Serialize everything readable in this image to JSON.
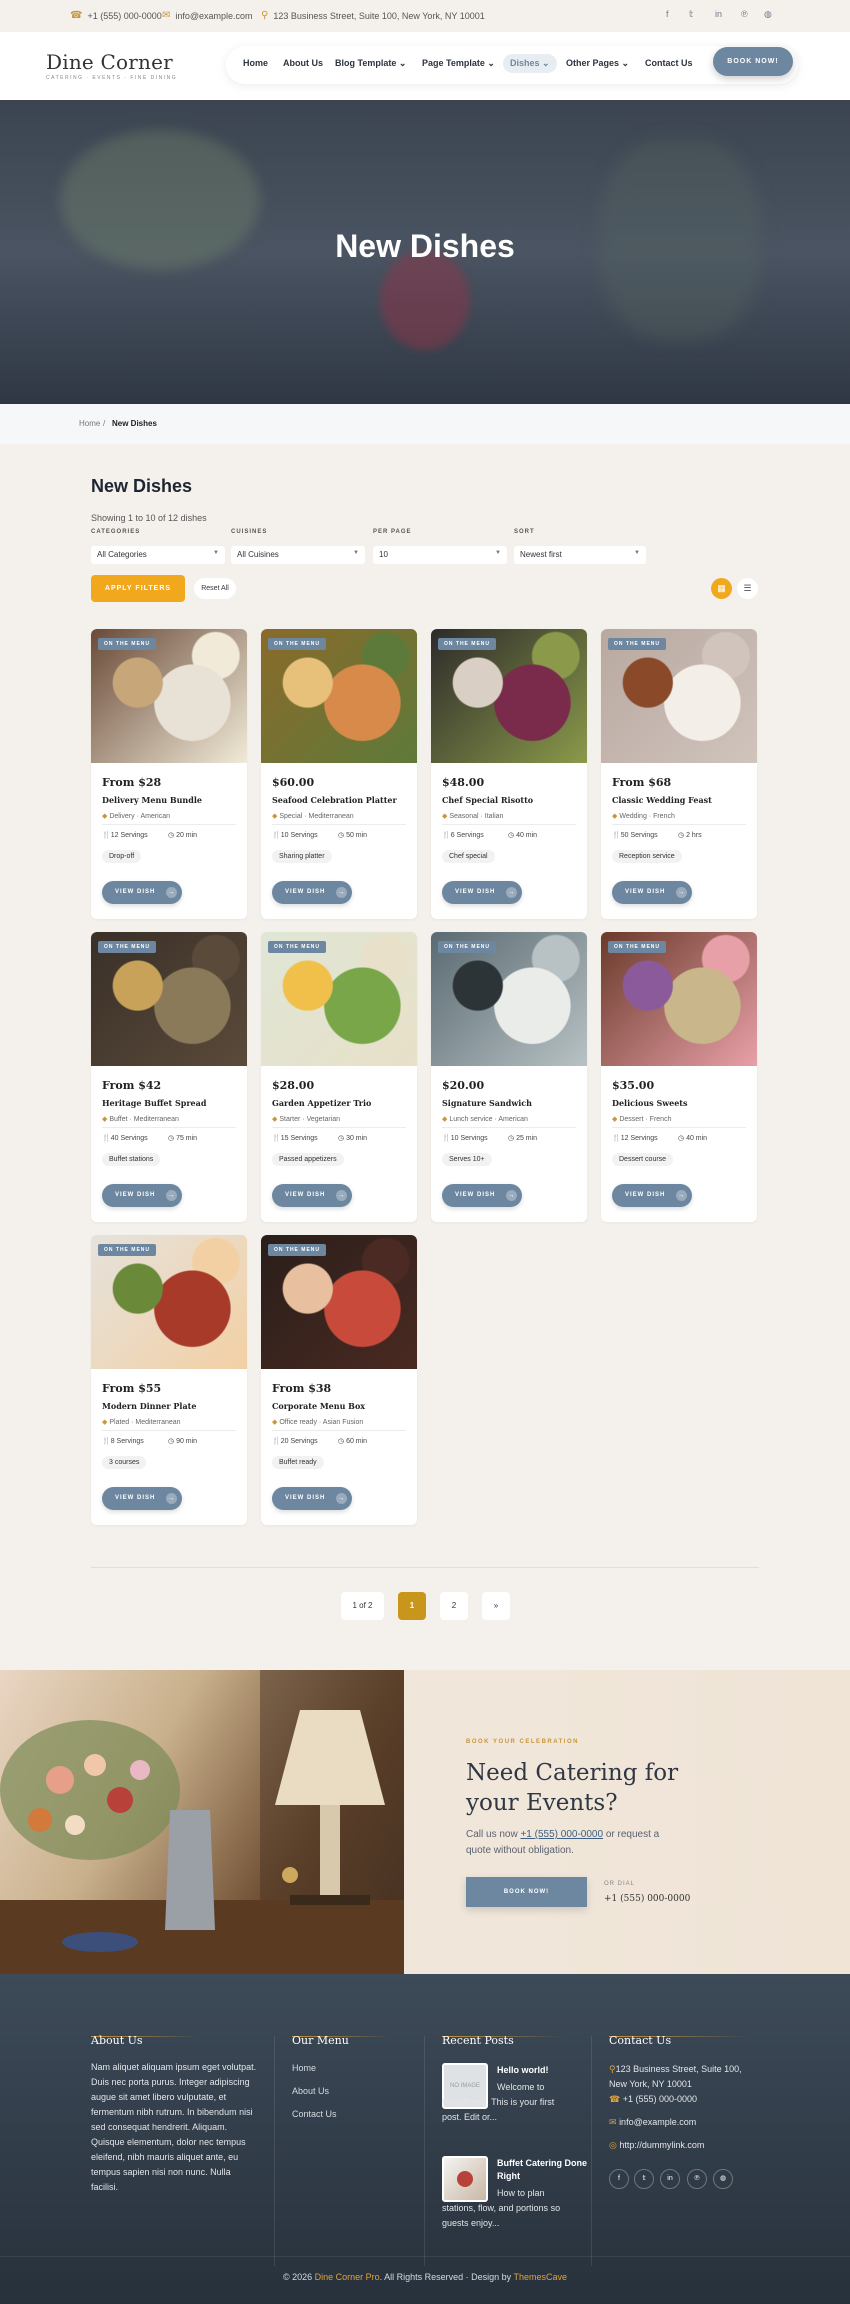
{
  "topbar": {
    "phone": "+1 (555) 000-0000",
    "email": "info@example.com",
    "address": "123 Business Street, Suite 100, New York, NY 10001",
    "social": [
      "facebook-icon",
      "twitter-icon",
      "linkedin-icon",
      "pinterest-icon",
      "dribbble-icon"
    ]
  },
  "header": {
    "logo_name": "Dine Corner",
    "logo_tagline": "CATERING · EVENTS · FINE DINING",
    "nav": [
      "Home",
      "About Us",
      "Blog Template",
      "Page Template",
      "Dishes",
      "Other Pages",
      "Contact Us"
    ],
    "book_label": "BOOK NOW!"
  },
  "hero": {
    "title": "New Dishes"
  },
  "breadcrumb": {
    "home": "Home",
    "sep": "/",
    "current": "New Dishes"
  },
  "listing": {
    "title": "New Dishes",
    "showing": "Showing 1 to 10 of 12 dishes",
    "filters": {
      "categories_label": "CATEGORIES",
      "categories_value": "All Categories",
      "cuisines_label": "CUISINES",
      "cuisines_value": "All Cuisines",
      "per_page_label": "PER PAGE",
      "per_page_value": "10",
      "sort_label": "SORT",
      "sort_value": "Newest first"
    },
    "apply_label": "APPLY FILTERS",
    "reset_label": "Reset All",
    "badge_label": "ON THE MENU",
    "view_label": "VIEW DISH",
    "dishes": [
      {
        "price": "From $28",
        "title": "Delivery Menu Bundle",
        "meta": "Delivery · American",
        "servings": "12 Servings",
        "time": "20 min",
        "tag": "Drop-off"
      },
      {
        "price": "$60.00",
        "title": "Seafood Celebration Platter",
        "meta": "Special · Mediterranean",
        "servings": "10 Servings",
        "time": "50 min",
        "tag": "Sharing platter"
      },
      {
        "price": "$48.00",
        "title": "Chef Special Risotto",
        "meta": "Seasonal · Italian",
        "servings": "6 Servings",
        "time": "40 min",
        "tag": "Chef special"
      },
      {
        "price": "From $68",
        "title": "Classic Wedding Feast",
        "meta": "Wedding · French",
        "servings": "50 Servings",
        "time": "2 hrs",
        "tag": "Reception service"
      },
      {
        "price": "From $42",
        "title": "Heritage Buffet Spread",
        "meta": "Buffet · Mediterranean",
        "servings": "40 Servings",
        "time": "75 min",
        "tag": "Buffet stations"
      },
      {
        "price": "$28.00",
        "title": "Garden Appetizer Trio",
        "meta": "Starter · Vegetarian",
        "servings": "15 Servings",
        "time": "30 min",
        "tag": "Passed appetizers"
      },
      {
        "price": "$20.00",
        "title": "Signature Sandwich",
        "meta": "Lunch service · American",
        "servings": "10 Servings",
        "time": "25 min",
        "tag": "Serves 10+"
      },
      {
        "price": "$35.00",
        "title": "Delicious Sweets",
        "meta": "Dessert · French",
        "servings": "12 Servings",
        "time": "40 min",
        "tag": "Dessert course"
      },
      {
        "price": "From $55",
        "title": "Modern Dinner Plate",
        "meta": "Plated · Mediterranean",
        "servings": "8 Servings",
        "time": "90 min",
        "tag": "3 courses"
      },
      {
        "price": "From $38",
        "title": "Corporate Menu Box",
        "meta": "Office ready · Asian Fusion",
        "servings": "20 Servings",
        "time": "60 min",
        "tag": "Buffet ready"
      }
    ]
  },
  "pagination": {
    "summary": "1 of 2",
    "current": "1",
    "next_page": "2",
    "next": "»"
  },
  "catering": {
    "kicker": "BOOK YOUR CELEBRATION",
    "title": "Need Catering for your Events?",
    "desc_prefix": "Call us now ",
    "desc_phone": "+1 (555) 000-0000",
    "desc_suffix": " or request a quote without obligation.",
    "button": "BOOK NOW!",
    "or_dial": "OR DIAL",
    "phone": "+1 (555) 000-0000"
  },
  "footer": {
    "about_title": "About Us",
    "about_text": "Nam aliquet aliquam ipsum eget volutpat. Duis nec porta purus. Integer adipiscing augue sit amet libero vulputate, et fermentum nibh rutrum. In bibendum nisi sed consequat hendrerit. Aliquam. Quisque elementum, dolor nec tempus eleifend, nibh mauris aliquet ante, eu tempus sapien nisi non nunc. Nulla facilisi.",
    "menu_title": "Our Menu",
    "menu": [
      "Home",
      "About Us",
      "Contact Us"
    ],
    "posts_title": "Recent Posts",
    "posts": [
      {
        "title": "Hello world!",
        "excerpt": "Welcome to WordPress. This is your first post. Edit or...",
        "thumb": "NO IMAGE"
      },
      {
        "title": "Buffet Catering Done Right",
        "excerpt": "How to plan stations, flow, and portions so guests enjoy..."
      }
    ],
    "contact_title": "Contact Us",
    "contact_address": "123 Business Street, Suite 100, New York, NY 10001",
    "contact_phone": "+1 (555) 000-0000",
    "contact_email": "info@example.com",
    "contact_web": "http://dummylink.com",
    "copyright_prefix": "© 2026 ",
    "copyright_brand": "Dine Corner Pro",
    "copyright_mid": ". All Rights Reserved  ·  Design by ",
    "copyright_designer": "ThemesCave"
  },
  "colors": {
    "accent": "#6d87a0",
    "gold": "#c8963e",
    "orange": "#f2a81d",
    "footer": "#2f3a46"
  }
}
